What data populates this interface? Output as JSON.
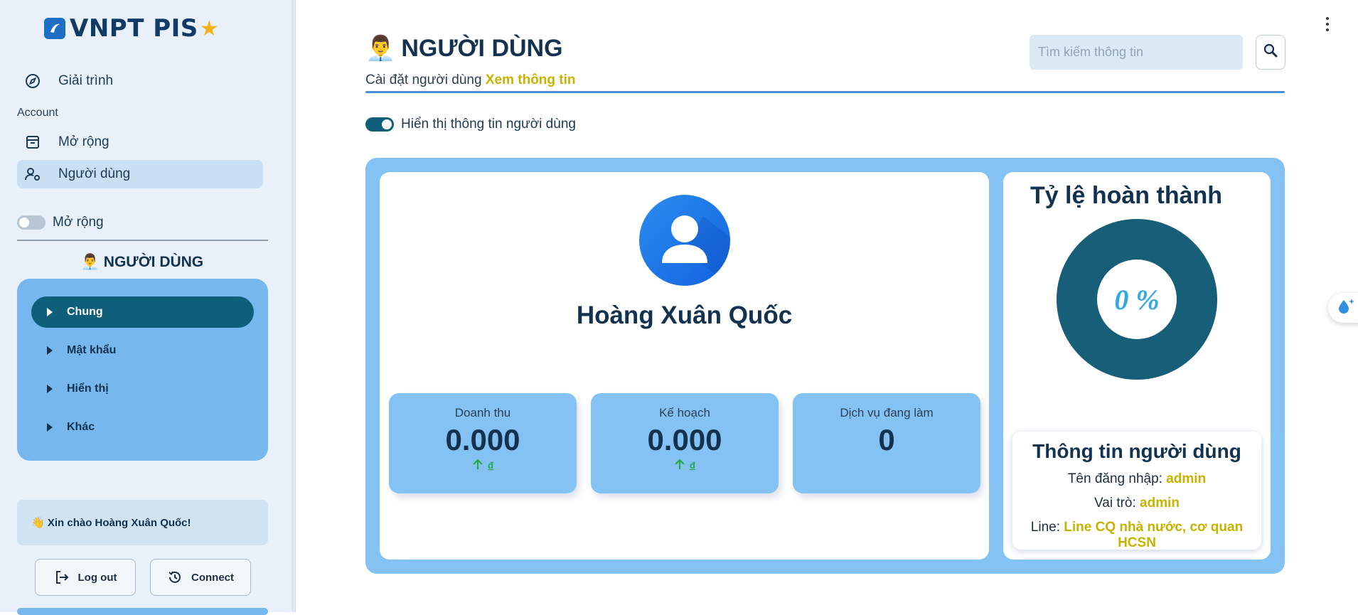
{
  "app": {
    "logo_text": "VNPT PIS",
    "logo_star": "★"
  },
  "sidebar": {
    "top_item": {
      "label": "Giải trình"
    },
    "section_label": "Account",
    "items": [
      {
        "label": "Mở rộng"
      },
      {
        "label": "Người dùng"
      }
    ],
    "toggle_label": "Mở rộng",
    "section_title": "👨‍💼 NGƯỜI DÙNG",
    "menu": [
      {
        "label": "Chung",
        "active": true
      },
      {
        "label": "Mật khẩu"
      },
      {
        "label": "Hiển thị"
      },
      {
        "label": "Khác"
      }
    ],
    "greeting": "👋 Xin chào Hoàng Xuân Quốc!",
    "logout_label": "Log out",
    "connect_label": "Connect"
  },
  "header": {
    "emoji": "👨‍💼",
    "title": "NGƯỜI DÙNG",
    "subtitle": "Cài đặt người dùng",
    "subtitle_link": "Xem thông tin",
    "search_placeholder": "Tìm kiếm thông tin"
  },
  "main": {
    "toggle_label": "Hiển thị thông tin người dùng",
    "user_name": "Hoàng Xuân Quốc",
    "stats": [
      {
        "label": "Doanh thu",
        "value": "0.000",
        "currency": "đ",
        "trend": "up"
      },
      {
        "label": "Kế hoạch",
        "value": "0.000",
        "currency": "đ",
        "trend": "up"
      },
      {
        "label": "Dịch vụ đang làm",
        "value": "0"
      }
    ]
  },
  "completion": {
    "title": "Tỷ lệ hoàn thành",
    "percent_text": "0 %",
    "percent_value": 0
  },
  "user_info": {
    "title": "Thông tin người dùng",
    "username_label": "Tên đăng nhập:",
    "username": "admin",
    "role_label": "Vai trò:",
    "role": "admin",
    "line_label": "Line:",
    "line": "Line CQ nhà nước, cơ quan HCSN"
  },
  "colors": {
    "accent": "#0f5f7b",
    "panel": "#84c2f4",
    "highlight": "#c8b200",
    "trend_up": "#2aa84a"
  }
}
